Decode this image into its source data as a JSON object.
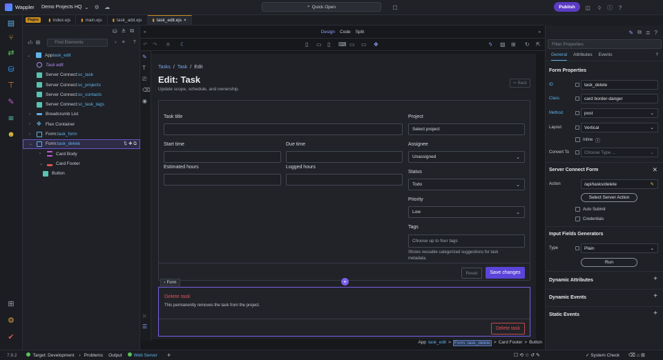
{
  "app": {
    "name": "Wappler",
    "project": "Demo Projects HQ",
    "quick_open": "Quick Open",
    "publish": "Publish",
    "version": "7.9.2"
  },
  "tabs": {
    "pages_badge": "Pages",
    "files": [
      "index.ejs",
      "main.ejs",
      "task_add.ejs",
      "task_edit.ejs"
    ],
    "close": "×"
  },
  "left_panel": {
    "search_placeholder": "Find Elements",
    "tree": [
      {
        "prefix": "App ",
        "value": "task_edit"
      },
      {
        "prefix": "Task edit",
        "value": ""
      },
      {
        "prefix": "Server Connect: ",
        "value": "sc_task"
      },
      {
        "prefix": "Server Connect: ",
        "value": "sc_projects"
      },
      {
        "prefix": "Server Connect: ",
        "value": "sc_contacts"
      },
      {
        "prefix": "Server Connect: ",
        "value": "sc_task_tags"
      },
      {
        "prefix": "Breadcrumb List",
        "value": ""
      },
      {
        "prefix": "Flex Container",
        "value": ""
      },
      {
        "prefix": "Form: ",
        "value": "task_form"
      },
      {
        "prefix": "Form: ",
        "value": "task_delete"
      },
      {
        "prefix": "Card Body",
        "value": ""
      },
      {
        "prefix": "Card Footer",
        "value": ""
      },
      {
        "prefix": "Button",
        "value": ""
      }
    ]
  },
  "view_modes": {
    "design": "Design",
    "code": "Code",
    "split": "Split"
  },
  "page": {
    "breadcrumb": {
      "tasks": "Tasks",
      "task": "Task",
      "current": "Edit",
      "sep": "/"
    },
    "title": "Edit: Task",
    "subtitle": "Update scope, schedule, and ownership.",
    "back": "Back",
    "form": {
      "task_title": "Task title",
      "start_time": "Start time",
      "due_time": "Due time",
      "estimated_hours": "Estimated hours",
      "logged_hours": "Logged hours",
      "project": "Project",
      "project_value": "Select project",
      "assignee": "Assignee",
      "assignee_value": "Unassigned",
      "status": "Status",
      "status_value": "Todo",
      "priority": "Priority",
      "priority_value": "Low",
      "tags": "Tags",
      "tags_placeholder": "Choose up to four tags",
      "tags_help": "Shows reusable categorized suggestions for task metadata.",
      "reset": "Reset",
      "save": "Save changes"
    },
    "form_tag": "Form",
    "delete_card": {
      "title": "Delete task",
      "description": "This permanently removes the task from the project.",
      "button": "Delete task"
    }
  },
  "status_breadcrumb": {
    "app": "App",
    "app_value": "task_edit",
    "form": "Form: task_delete",
    "footer": "Card Footer",
    "button": "Button",
    "sep": ">"
  },
  "properties": {
    "filter_placeholder": "Filter Properties",
    "tabs": [
      "General",
      "Attributes",
      "Events"
    ],
    "form_properties": "Form Properties",
    "id_label": "ID",
    "id_value": "task_delete",
    "class_label": "Class",
    "class_value": "card border-danger",
    "method_label": "Method",
    "method_value": "post",
    "layout_label": "Layout",
    "layout_value": "Vertical",
    "inline_label": "Inline",
    "convert_label": "Convert To",
    "convert_placeholder": "Choose Type ...",
    "sc_form": "Server Connect Form",
    "action_label": "Action",
    "action_value": "/api/tasks/delete",
    "select_action": "Select Server Action",
    "auto_submit": "Auto Submit",
    "credentials": "Credentials",
    "input_generators": "Input Fields Generators",
    "type_label": "Type",
    "type_value": "Plain",
    "run": "Run",
    "dynamic_attributes": "Dynamic Attributes",
    "dynamic_events": "Dynamic Events",
    "static_events": "Static Events"
  },
  "statusbar": {
    "target": "Target: Development",
    "problems": "Problems",
    "output": "Output",
    "web_server": "Web Server",
    "system_check": "System Check"
  },
  "colors": {
    "accent": "#5b44d9",
    "danger": "#e05252",
    "link": "#5fb3e8"
  }
}
